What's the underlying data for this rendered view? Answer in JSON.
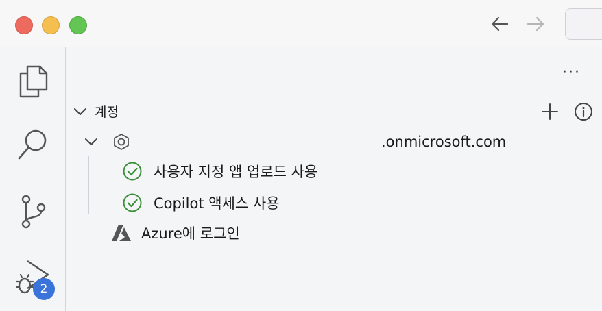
{
  "window": {
    "nav_back_label": "back",
    "nav_forward_label": "forward"
  },
  "activity_bar": {
    "badge_count": "2"
  },
  "panel": {
    "more_label": "···",
    "section_title": "계정",
    "tenant_domain": ".onmicrosoft.com",
    "items": [
      {
        "label": "사용자 지정 앱 업로드 사용"
      },
      {
        "label": "Copilot 액세스 사용"
      }
    ],
    "azure_signin": "Azure에 로그인"
  },
  "colors": {
    "check_green": "#3a8f3a",
    "badge_blue": "#3a73d9"
  }
}
